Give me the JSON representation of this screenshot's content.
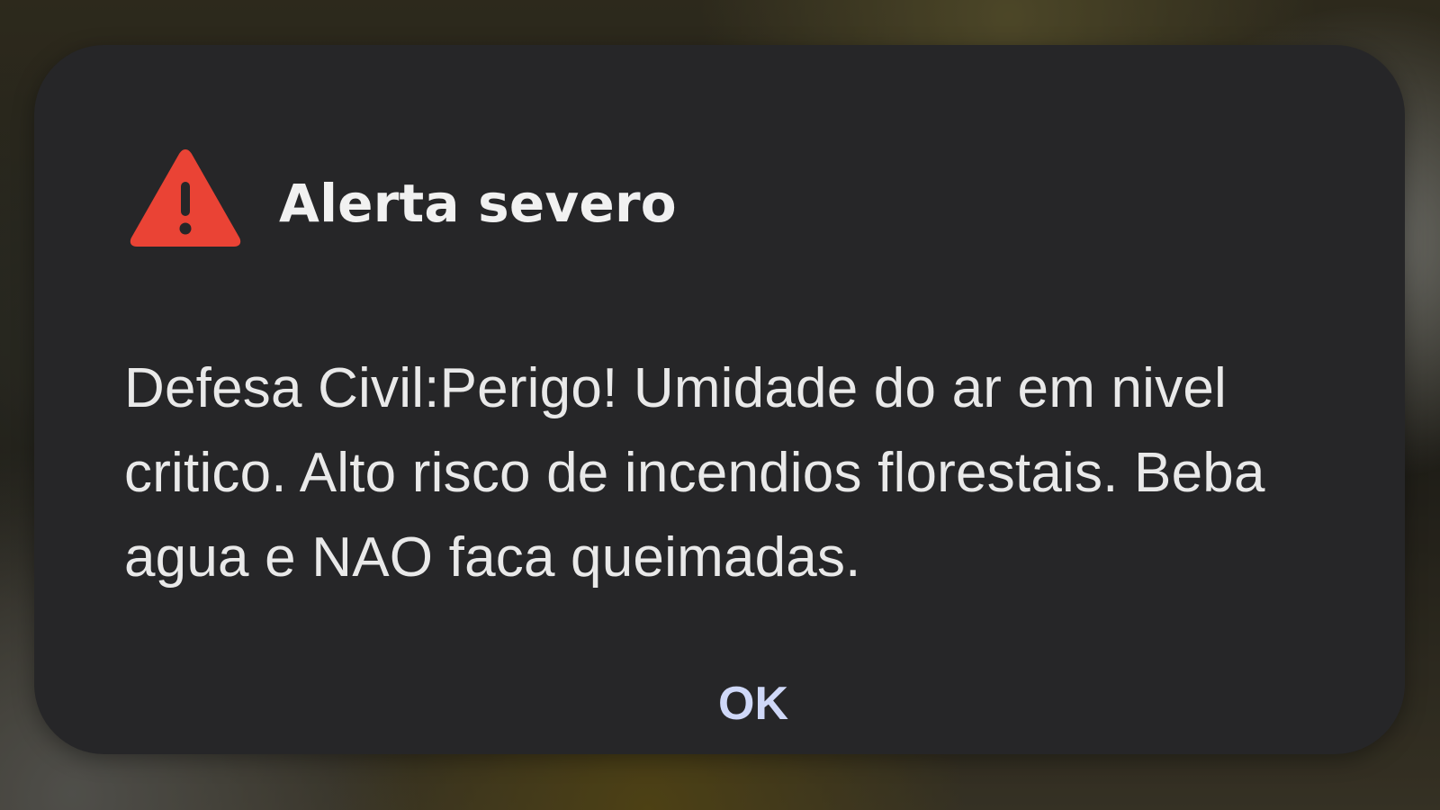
{
  "alert": {
    "icon": "warning-triangle-icon",
    "icon_color": "#EA4335",
    "title": "Alerta severo",
    "message": "Defesa Civil:Perigo! Umidade do ar em nivel critico. Alto risco de incendios florestais. Beba agua e NAO faca queimadas.",
    "ok_label": "OK",
    "ok_color": "#CFD8F8",
    "background_color": "#262628"
  }
}
